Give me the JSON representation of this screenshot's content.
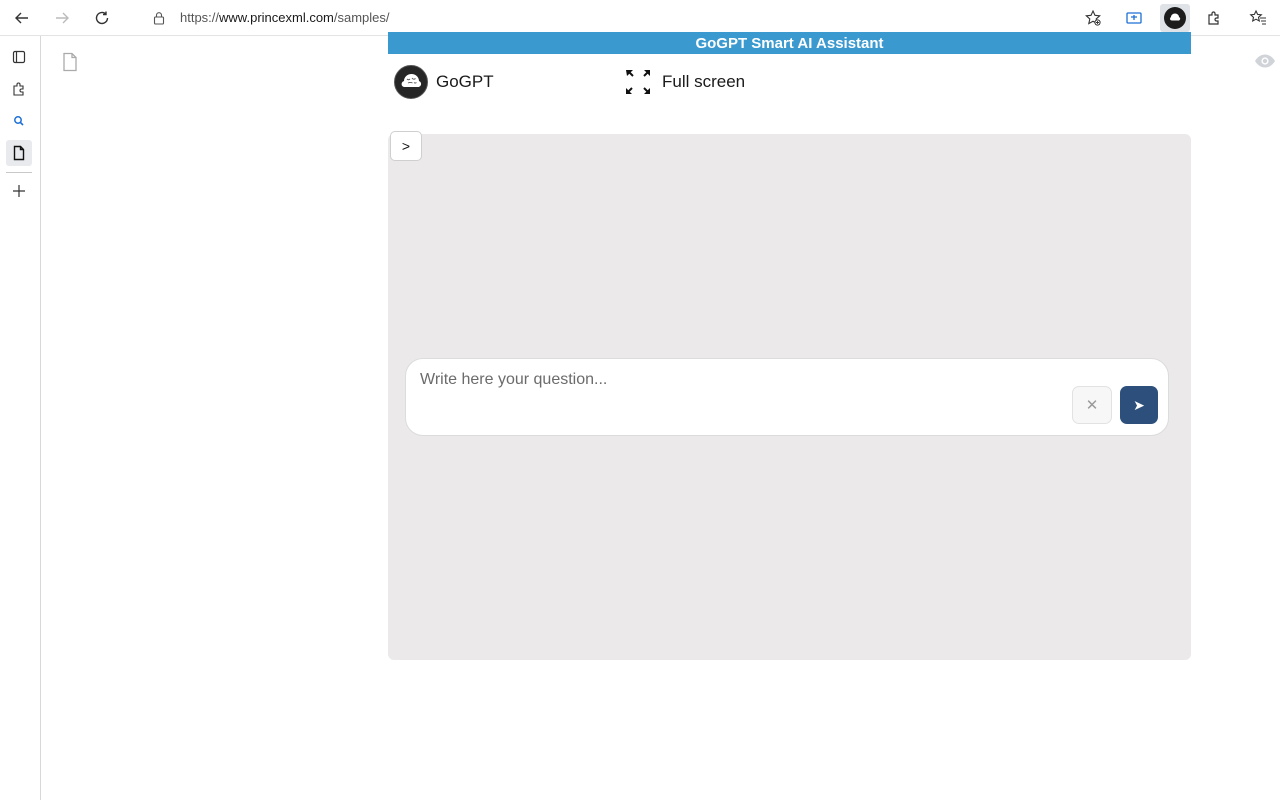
{
  "browser": {
    "url_scheme": "https://",
    "url_host": "www.princexml.com",
    "url_path": "/samples/",
    "icons": [
      "back-icon",
      "forward-icon",
      "refresh-icon",
      "lock-icon",
      "favorite-add-icon",
      "collections-icon",
      "gogpt-extension-icon",
      "extensions-icon",
      "favorites-icon"
    ]
  },
  "leftbar": {
    "icons": [
      "tabs-icon",
      "extensions-icon",
      "search-icon",
      "document-icon",
      "add-icon"
    ]
  },
  "panel": {
    "header_title": "GoGPT Smart AI Assistant",
    "brand_name": "GoGPT",
    "fullscreen_label": "Full screen",
    "toggle_label": ">",
    "input_placeholder": "Write here your question...",
    "input_value": "",
    "clear_label": "✕",
    "send_label": "➤"
  },
  "colors": {
    "header_bg": "#3a99cf",
    "chat_bg": "#ebe9ea",
    "send_bg": "#2c4f7c"
  }
}
